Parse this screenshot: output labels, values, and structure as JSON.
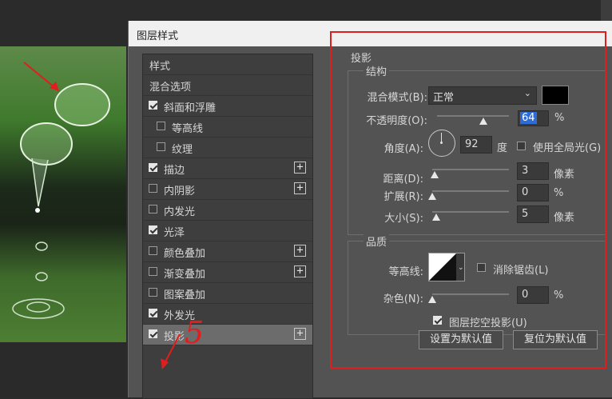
{
  "window": {
    "title": "图层样式"
  },
  "style_list": {
    "header": "样式",
    "items": [
      {
        "label": "混合选项",
        "checkbox": false,
        "checked": false,
        "plus": false,
        "indent": false
      },
      {
        "label": "斜面和浮雕",
        "checkbox": true,
        "checked": true,
        "plus": false,
        "indent": false
      },
      {
        "label": "等高线",
        "checkbox": true,
        "checked": false,
        "plus": false,
        "indent": true
      },
      {
        "label": "纹理",
        "checkbox": true,
        "checked": false,
        "plus": false,
        "indent": true
      },
      {
        "label": "描边",
        "checkbox": true,
        "checked": true,
        "plus": true,
        "indent": false
      },
      {
        "label": "内阴影",
        "checkbox": true,
        "checked": false,
        "plus": true,
        "indent": false
      },
      {
        "label": "内发光",
        "checkbox": true,
        "checked": false,
        "plus": false,
        "indent": false
      },
      {
        "label": "光泽",
        "checkbox": true,
        "checked": true,
        "plus": false,
        "indent": false
      },
      {
        "label": "颜色叠加",
        "checkbox": true,
        "checked": false,
        "plus": true,
        "indent": false
      },
      {
        "label": "渐变叠加",
        "checkbox": true,
        "checked": false,
        "plus": true,
        "indent": false
      },
      {
        "label": "图案叠加",
        "checkbox": true,
        "checked": false,
        "plus": false,
        "indent": false
      },
      {
        "label": "外发光",
        "checkbox": true,
        "checked": true,
        "plus": false,
        "indent": false
      },
      {
        "label": "投影",
        "checkbox": true,
        "checked": true,
        "plus": true,
        "indent": false,
        "selected": true
      }
    ]
  },
  "annotation": {
    "handwritten_number": "5"
  },
  "drop_shadow": {
    "section_title": "投影",
    "structure": {
      "title": "结构",
      "blend_mode_label": "混合模式(B):",
      "blend_mode_value": "正常",
      "color": "#000000",
      "opacity_label": "不透明度(O):",
      "opacity_value": "64",
      "opacity_unit": "%",
      "opacity_level": 0.64,
      "angle_label": "角度(A):",
      "angle_value": "92",
      "angle_unit": "度",
      "global_light_label": "使用全局光(G)",
      "global_light_checked": false,
      "distance_label": "距离(D):",
      "distance_value": "3",
      "distance_unit": "像素",
      "spread_label": "扩展(R):",
      "spread_value": "0",
      "spread_unit": "%",
      "size_label": "大小(S):",
      "size_value": "5",
      "size_unit": "像素"
    },
    "quality": {
      "title": "品质",
      "contour_label": "等高线:",
      "anti_alias_label": "消除锯齿(L)",
      "anti_alias_checked": false,
      "noise_label": "杂色(N):",
      "noise_value": "0",
      "noise_unit": "%"
    },
    "knockout_label": "图层挖空投影(U)",
    "knockout_checked": true,
    "make_default_button": "设置为默认值",
    "reset_default_button": "复位为默认值"
  },
  "colors": {
    "annotation_red": "#e01e1e",
    "highlight_blue": "#2d6bd6"
  }
}
